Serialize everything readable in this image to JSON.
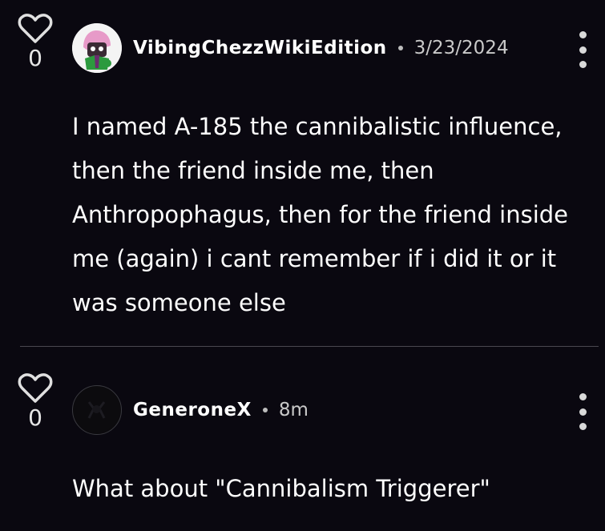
{
  "comments": [
    {
      "likes": "0",
      "username": "VibingChezzWikiEdition",
      "timestamp": "3/23/2024",
      "text": "I named A-185 the cannibalistic influence, then the friend inside me, then Anthropophagus, then for the friend inside me (again) i cant remember if i did it or it was someone else"
    },
    {
      "likes": "0",
      "username": "GeneroneX",
      "timestamp": "8m",
      "text": "What about \"Cannibalism Triggerer\""
    }
  ],
  "icons": {
    "like": "heart-outline-icon",
    "menu": "more-vertical-icon"
  },
  "colors": {
    "background": "#0a0810",
    "text": "#ffffff",
    "muted": "#c9c9c9",
    "divider": "#4a4850"
  }
}
